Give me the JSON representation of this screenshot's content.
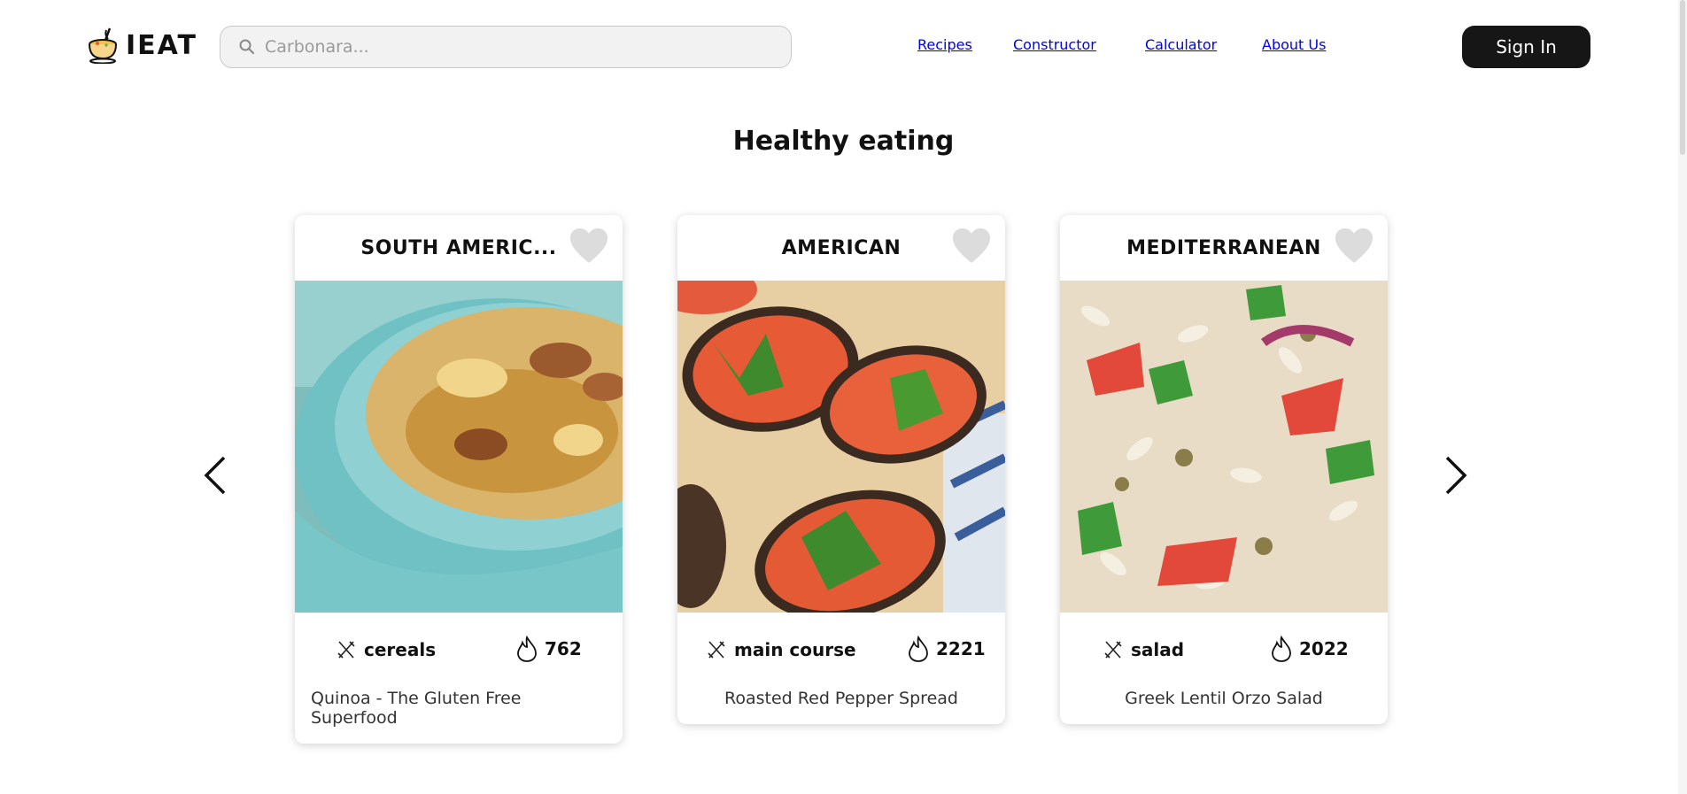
{
  "header": {
    "logo_text": "IEAT",
    "search_placeholder": "Carbonara...",
    "nav": [
      "Recipes",
      "Constructor",
      "Calculator",
      "About Us"
    ],
    "signin_label": "Sign In"
  },
  "section": {
    "title": "Healthy eating"
  },
  "cards": [
    {
      "cuisine": "SOUTH AMERIC...",
      "category": "cereals",
      "calories": "762",
      "title": "Quinoa - The Gluten Free Superfood"
    },
    {
      "cuisine": "AMERICAN",
      "category": "main course",
      "calories": "2221",
      "title": "Roasted Red Pepper Spread"
    },
    {
      "cuisine": "MEDITERRANEAN",
      "category": "salad",
      "calories": "2022",
      "title": "Greek Lentil Orzo Salad"
    }
  ],
  "colors": {
    "button_bg": "#161616",
    "heart": "#dcdcdc",
    "search_bg": "#f2f2f2"
  },
  "icons": {
    "logo": "soup-bowl-icon",
    "search": "search-icon",
    "favorite": "heart-icon",
    "category": "fork-knife-icon",
    "calories": "flame-icon",
    "prev": "chevron-left-icon",
    "next": "chevron-right-icon"
  }
}
